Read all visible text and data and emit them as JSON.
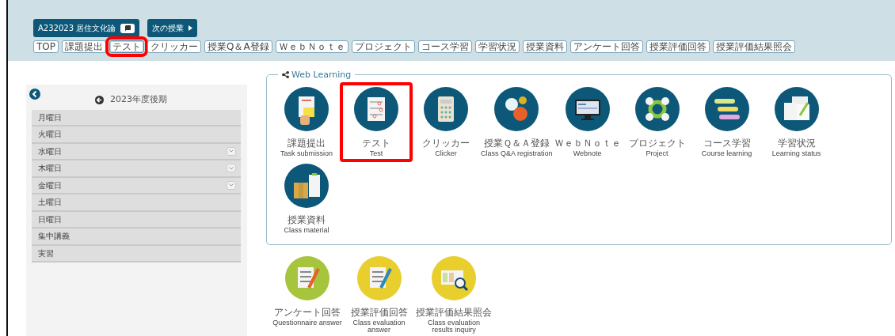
{
  "header": {
    "course_button": {
      "label": "A232023 居住文化論"
    },
    "next_button": {
      "label": "次の授業"
    },
    "tabs": [
      {
        "label": "TOP",
        "selected": false,
        "highlighted": false
      },
      {
        "label": "課題提出",
        "selected": false,
        "highlighted": false
      },
      {
        "label": "テスト",
        "selected": true,
        "highlighted": true
      },
      {
        "label": "クリッカー",
        "selected": false,
        "highlighted": false
      },
      {
        "label": "授業Q＆A登録",
        "selected": false,
        "highlighted": false
      },
      {
        "label": "ＷｅｂＮｏｔｅ",
        "selected": false,
        "highlighted": false
      },
      {
        "label": "プロジェクト",
        "selected": false,
        "highlighted": false
      },
      {
        "label": "コース学習",
        "selected": false,
        "highlighted": false
      },
      {
        "label": "学習状況",
        "selected": false,
        "highlighted": false
      },
      {
        "label": "授業資料",
        "selected": false,
        "highlighted": false
      },
      {
        "label": "アンケート回答",
        "selected": false,
        "highlighted": false
      },
      {
        "label": "授業評価回答",
        "selected": false,
        "highlighted": false
      },
      {
        "label": "授業評価結果照会",
        "selected": false,
        "highlighted": false
      }
    ]
  },
  "sidebar": {
    "term": "2023年度後期",
    "items": [
      {
        "label": "月曜日",
        "expandable": false
      },
      {
        "label": "火曜日",
        "expandable": false
      },
      {
        "label": "水曜日",
        "expandable": true
      },
      {
        "label": "木曜日",
        "expandable": true
      },
      {
        "label": "金曜日",
        "expandable": true
      },
      {
        "label": "土曜日",
        "expandable": false
      },
      {
        "label": "日曜日",
        "expandable": false
      },
      {
        "label": "集中講義",
        "expandable": false
      },
      {
        "label": "実習",
        "expandable": false
      }
    ]
  },
  "web_learning": {
    "title": "Web Learning",
    "tiles": [
      {
        "kind": "task",
        "label": "課題提出",
        "sublabel": "Task submission",
        "highlighted": false
      },
      {
        "kind": "test",
        "label": "テスト",
        "sublabel": "Test",
        "highlighted": true
      },
      {
        "kind": "clicker",
        "label": "クリッカー",
        "sublabel": "Clicker",
        "highlighted": false
      },
      {
        "kind": "qa",
        "label": "授業Ｑ＆Ａ登録",
        "sublabel": "Class Q&A registration",
        "highlighted": false
      },
      {
        "kind": "webnote",
        "label": "ＷｅｂＮｏｔｅ",
        "sublabel": "Webnote",
        "highlighted": false
      },
      {
        "kind": "project",
        "label": "プロジェクト",
        "sublabel": "Project",
        "highlighted": false
      },
      {
        "kind": "course",
        "label": "コース学習",
        "sublabel": "Course learning",
        "highlighted": false
      },
      {
        "kind": "status",
        "label": "学習状況",
        "sublabel": "Learning status",
        "highlighted": false
      },
      {
        "kind": "material",
        "label": "授業資料",
        "sublabel": "Class material",
        "highlighted": false
      }
    ]
  },
  "evaluation_tiles": [
    {
      "kind": "questionnaire",
      "label": "アンケート回答",
      "sublabel": "Questionnaire answer",
      "highlighted": false
    },
    {
      "kind": "evaluation",
      "label": "授業評価回答",
      "sublabel": "Class evaluation answer",
      "highlighted": false
    },
    {
      "kind": "results",
      "label": "授業評価結果照会",
      "sublabel": "Class evaluation results inquiry",
      "highlighted": false
    }
  ]
}
